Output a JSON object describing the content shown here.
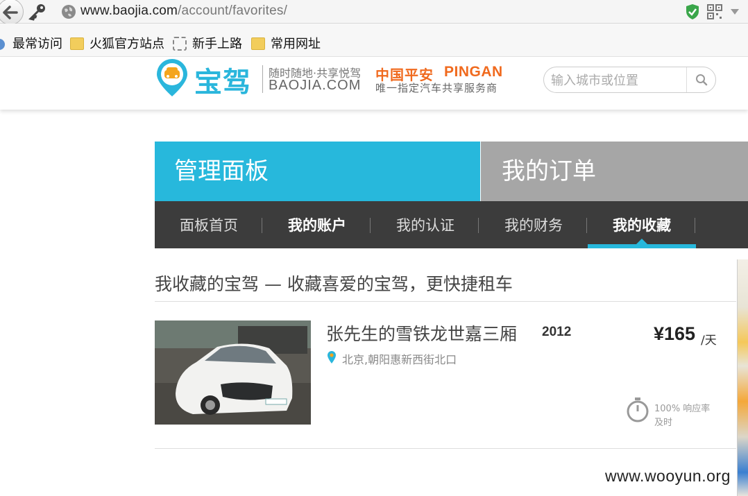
{
  "browser": {
    "url_domain": "www.baojia.com",
    "url_path": "/account/favorites/",
    "bookmarks": [
      "最常访问",
      "火狐官方站点",
      "新手上路",
      "常用网址"
    ]
  },
  "header": {
    "logo_text": "宝驾",
    "slogan": "随时随地·共享悦驾",
    "brand_en": "BAOJIA.COM",
    "partner_cn": "中国平安",
    "partner_en": "PINGAN",
    "partner_sub": "唯一指定汽车共享服务商",
    "search_placeholder": "输入城市或位置"
  },
  "tabs": {
    "panel": "管理面板",
    "orders": "我的订单"
  },
  "subnav": [
    {
      "label": "面板首页"
    },
    {
      "label": "我的账户"
    },
    {
      "label": "我的认证"
    },
    {
      "label": "我的财务"
    },
    {
      "label": "我的收藏"
    }
  ],
  "favorites": {
    "title": "我收藏的宝驾 — 收藏喜爱的宝驾，更快捷租车",
    "car": {
      "name": "张先生的雪铁龙世嘉三厢",
      "year": "2012",
      "price": "¥165",
      "unit": "/天",
      "location": "北京,朝阳惠新西街北口",
      "response_rate": "100% 响应率",
      "response_time": "及时"
    }
  },
  "watermark": "www.wooyun.org",
  "colors": {
    "accent": "#27b8dc",
    "orders_tab": "#a6a6a6",
    "subnav_bg": "#3c3c3c",
    "pingan_orange": "#f06a1e"
  }
}
